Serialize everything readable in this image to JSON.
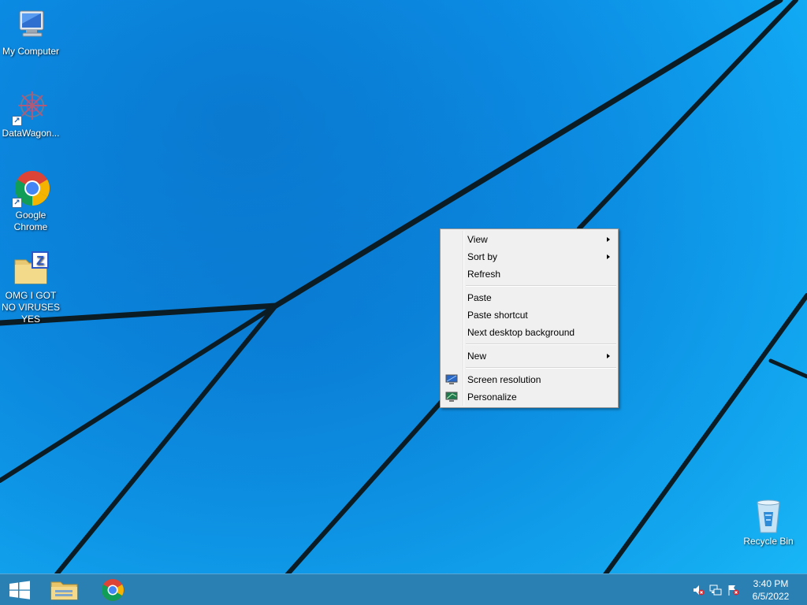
{
  "desktop": {
    "icons": [
      {
        "label": "My Computer",
        "icon": "computer-icon"
      },
      {
        "label": "DataWagon...",
        "icon": "datawagon-icon"
      },
      {
        "label": "Google Chrome",
        "icon": "chrome-icon"
      },
      {
        "label": "OMG I GOT NO VIRUSES YES",
        "icon": "zip-folder-icon"
      },
      {
        "label": "Recycle Bin",
        "icon": "recycle-bin-icon"
      }
    ]
  },
  "context_menu": {
    "items": [
      {
        "label": "View",
        "submenu": true
      },
      {
        "label": "Sort by",
        "submenu": true
      },
      {
        "label": "Refresh"
      },
      {
        "label": "Paste"
      },
      {
        "label": "Paste shortcut"
      },
      {
        "label": "Next desktop background"
      },
      {
        "label": "New",
        "submenu": true
      },
      {
        "label": "Screen resolution",
        "icon": "screen-resolution-icon"
      },
      {
        "label": "Personalize",
        "icon": "personalize-icon"
      }
    ]
  },
  "taskbar": {
    "pinned": [
      {
        "name": "file-explorer",
        "icon": "folder-icon"
      },
      {
        "name": "chrome",
        "icon": "chrome-icon"
      }
    ],
    "tray": {
      "time": "3:40 PM",
      "date": "6/5/2022",
      "icons": [
        "speaker-muted-icon",
        "network-icon",
        "action-center-flag-icon"
      ]
    }
  },
  "colors": {
    "wallpaper": "#0b8fe8",
    "taskbar": "#2a7fb3",
    "menu_bg": "#f0f0f0"
  }
}
